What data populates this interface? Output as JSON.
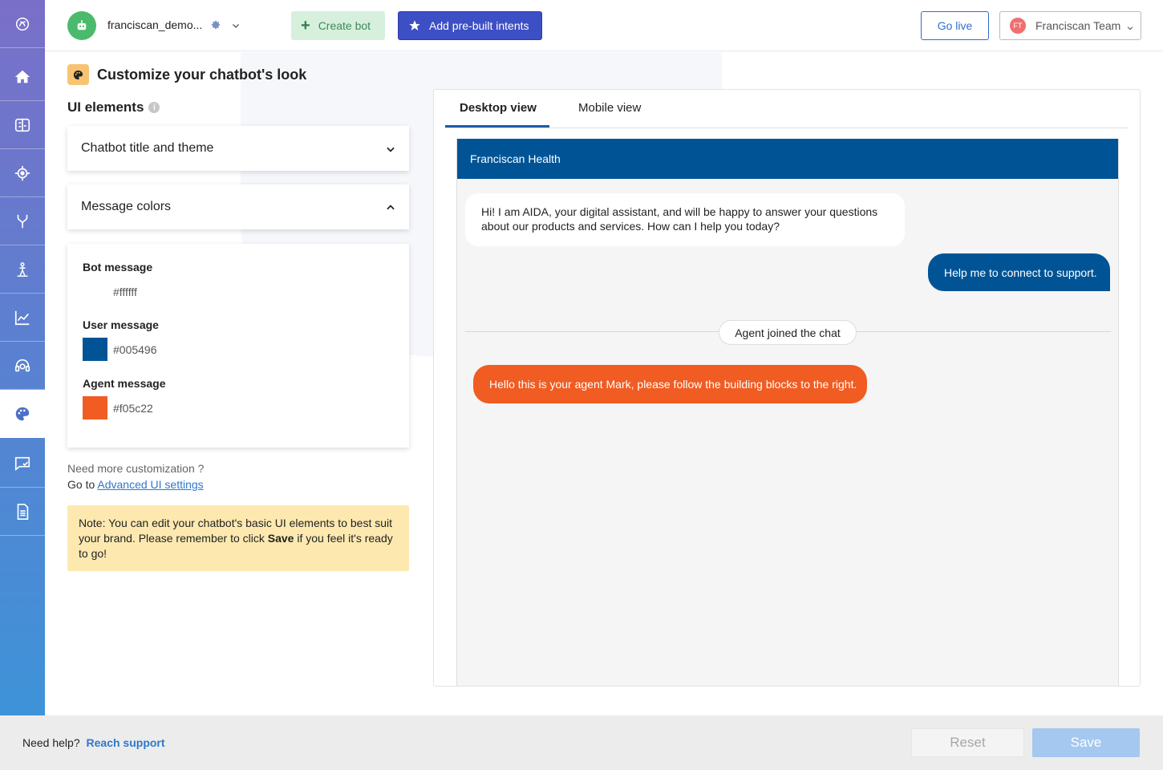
{
  "header": {
    "bot_name": "franciscan_demo...",
    "create_bot_label": "Create bot",
    "add_intents_label": "Add pre-built intents",
    "go_live_label": "Go live",
    "team_initials": "FT",
    "team_name": "Franciscan Team"
  },
  "sidebar": {
    "items": [
      {
        "icon": "logo-icon"
      },
      {
        "icon": "home-icon"
      },
      {
        "icon": "brain-icon"
      },
      {
        "icon": "target-icon"
      },
      {
        "icon": "branch-icon"
      },
      {
        "icon": "training-icon"
      },
      {
        "icon": "analytics-icon"
      },
      {
        "icon": "support-icon"
      },
      {
        "icon": "palette-icon",
        "active": true
      },
      {
        "icon": "chat-check-icon"
      },
      {
        "icon": "document-icon"
      }
    ]
  },
  "main": {
    "page_title": "Customize your chatbot's look",
    "section_title": "UI elements",
    "accordions": [
      {
        "label": "Chatbot title and theme",
        "expanded": false
      },
      {
        "label": "Message colors",
        "expanded": true
      }
    ],
    "message_colors": {
      "bot": {
        "label": "Bot message",
        "hex": "#ffffff"
      },
      "user": {
        "label": "User message",
        "hex": "#005496"
      },
      "agent": {
        "label": "Agent message",
        "hex": "#f05c22"
      }
    },
    "need_more": "Need more customization ?",
    "goto_prefix": "Go to",
    "advanced_link": "Advanced UI settings",
    "note": {
      "text_1": "Note: You can edit your chatbot's basic UI elements to best suit your brand. Please remember to click ",
      "bold": "Save",
      "text_2": " if you feel it's ready to go!"
    }
  },
  "preview": {
    "tabs": [
      "Desktop view",
      "Mobile view"
    ],
    "active_tab": "Desktop view",
    "chat_title": "Franciscan Health",
    "bot_message": "Hi! I am AIDA, your digital assistant, and will be happy to answer your questions about our products and services. How can I help you today?",
    "user_message": "Help me to connect to support.",
    "agent_joined": "Agent joined the chat",
    "agent_message": "Hello this is your agent Mark, please follow the building blocks to the right."
  },
  "footer": {
    "help_text": "Need help?",
    "help_link": "Reach support",
    "reset_label": "Reset",
    "save_label": "Save"
  },
  "colors": {
    "sidebar_top": "#7a6fc8",
    "sidebar_bottom": "#3e93d8",
    "primary": "#3d4fc4",
    "link": "#2f78c9"
  }
}
